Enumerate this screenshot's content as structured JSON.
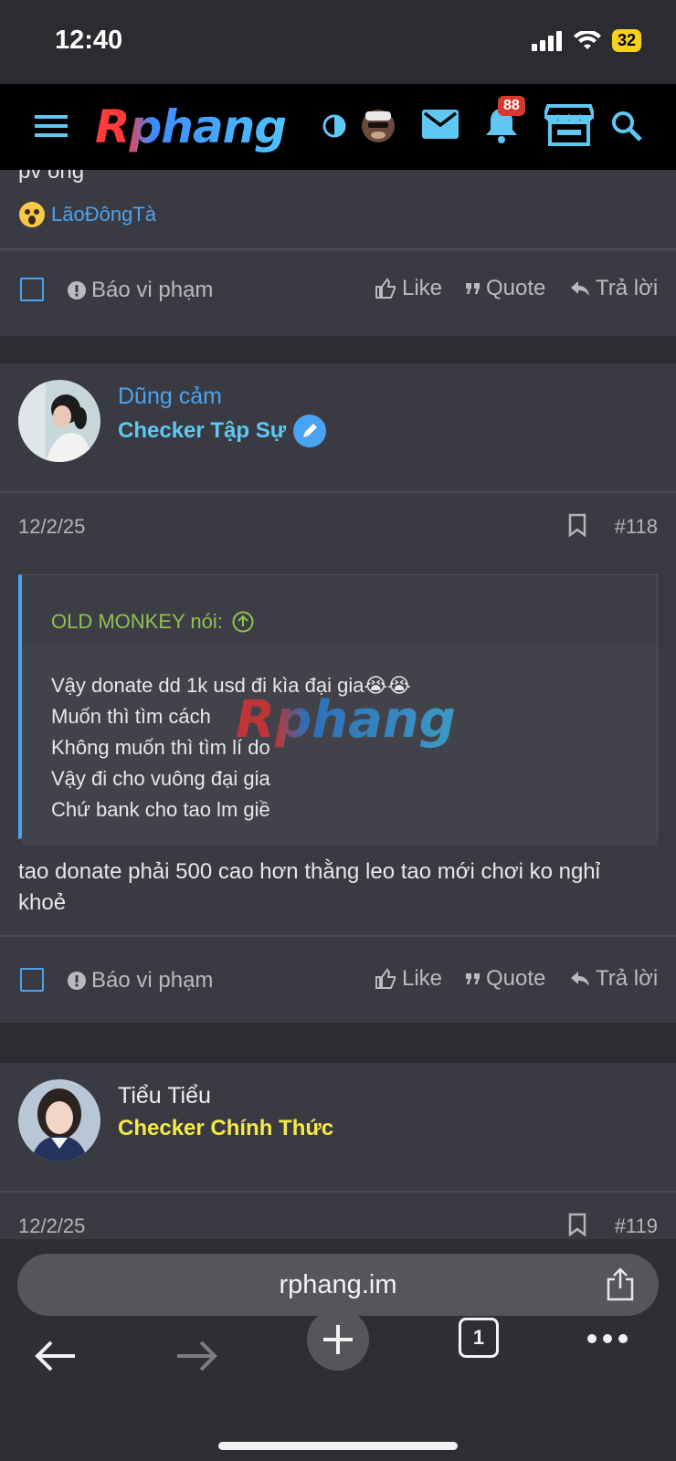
{
  "status": {
    "time": "12:40",
    "battery": "32"
  },
  "nav": {
    "bell_badge": "88",
    "logo": "Rphang"
  },
  "prev_post": {
    "tail_text": "pv ông",
    "reactor": "LãoĐôngTà",
    "report_label": "Báo vi phạm",
    "like_label": "Like",
    "quote_label": "Quote",
    "reply_label": "Trả lời"
  },
  "post_118": {
    "username": "Dũng cảm",
    "user_title": "Checker Tập Sự",
    "date": "12/2/25",
    "post_number": "#118",
    "quote_author": "OLD MONKEY nói:",
    "quote_lines": [
      "Vậy donate dd 1k usd đi kìa đại gia😭😭",
      "Muốn thì tìm cách",
      "Không muốn thì tìm lí do",
      "Vậy đi cho vuông đại gia",
      "Chứ bank cho tao lm giề"
    ],
    "body_lines": [
      "tao donate phải 500 cao hơn thằng leo tao mới chơi ko nghỉ",
      "khoẻ"
    ],
    "report_label": "Báo vi phạm",
    "like_label": "Like",
    "quote_label": "Quote",
    "reply_label": "Trả lời"
  },
  "post_119": {
    "username": "Tiểu Tiểu",
    "user_title": "Checker Chính Thức",
    "date": "12/2/25",
    "post_number": "#119"
  },
  "watermark": "Rphang",
  "browser": {
    "url": "rphang.im",
    "tab_count": "1"
  },
  "colors": {
    "link_blue": "#4aa3f0",
    "title_cyan": "#5ec8f2",
    "title_yellow": "#f5e94a",
    "quote_green": "#8ec24f",
    "badge_red": "#d63a2f"
  }
}
